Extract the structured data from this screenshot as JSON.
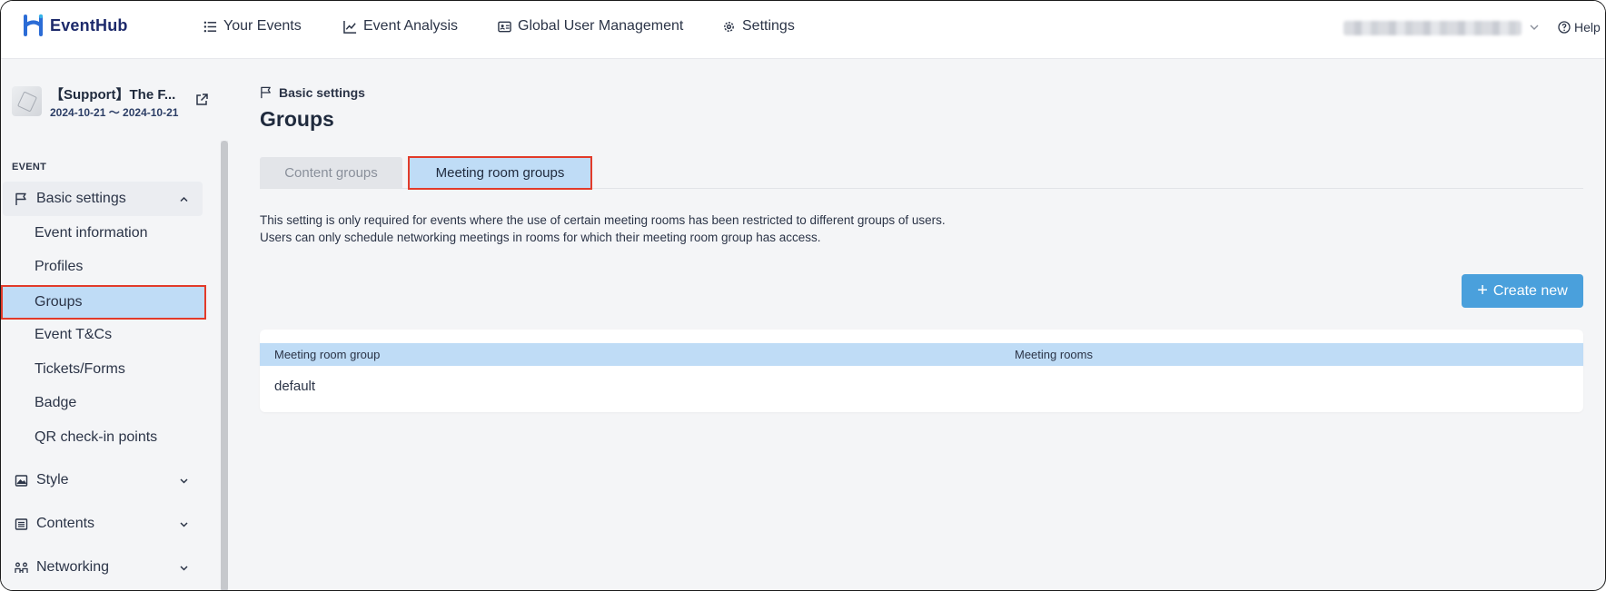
{
  "app": {
    "logo_text": "EventHub",
    "brand_color": "#1d2a6b"
  },
  "topnav": {
    "items": [
      {
        "label": "Your Events",
        "icon": "list-icon"
      },
      {
        "label": "Event Analysis",
        "icon": "chart-line-icon"
      },
      {
        "label": "Global User Management",
        "icon": "id-card-icon"
      },
      {
        "label": "Settings",
        "icon": "gear-icon"
      }
    ],
    "help_label": "Help"
  },
  "sidebar": {
    "event_title": "【Support】The F...",
    "event_dates": "2024-10-21 ～ 2024-10-21",
    "section_label": "EVENT",
    "basic_settings": {
      "label": "Basic settings",
      "icon": "flag-icon",
      "expanded": true,
      "items": [
        {
          "label": "Event information"
        },
        {
          "label": "Profiles"
        },
        {
          "label": "Groups",
          "active": true
        },
        {
          "label": "Event T&Cs"
        },
        {
          "label": "Tickets/Forms"
        },
        {
          "label": "Badge"
        },
        {
          "label": "QR check-in points"
        }
      ]
    },
    "collapsed_sections": [
      {
        "label": "Style",
        "icon": "image-icon"
      },
      {
        "label": "Contents",
        "icon": "list-alt-icon"
      },
      {
        "label": "Networking",
        "icon": "networking-icon"
      }
    ]
  },
  "main": {
    "breadcrumb": "Basic settings",
    "title": "Groups",
    "tabs": [
      {
        "label": "Content groups",
        "active": false
      },
      {
        "label": "Meeting room groups",
        "active": true
      }
    ],
    "description": [
      "This setting is only required for events where the use of certain meeting rooms has been restricted to different groups of users.",
      "Users can only schedule networking meetings in rooms for which their meeting room group has access."
    ],
    "create_button": "Create new",
    "table": {
      "headers": [
        "Meeting room group",
        "Meeting rooms"
      ],
      "rows": [
        [
          "default",
          ""
        ]
      ]
    }
  },
  "colors": {
    "accent": "#4aa0dc",
    "highlight": "#bfdcf6",
    "annotation_red": "#e23b2a"
  }
}
